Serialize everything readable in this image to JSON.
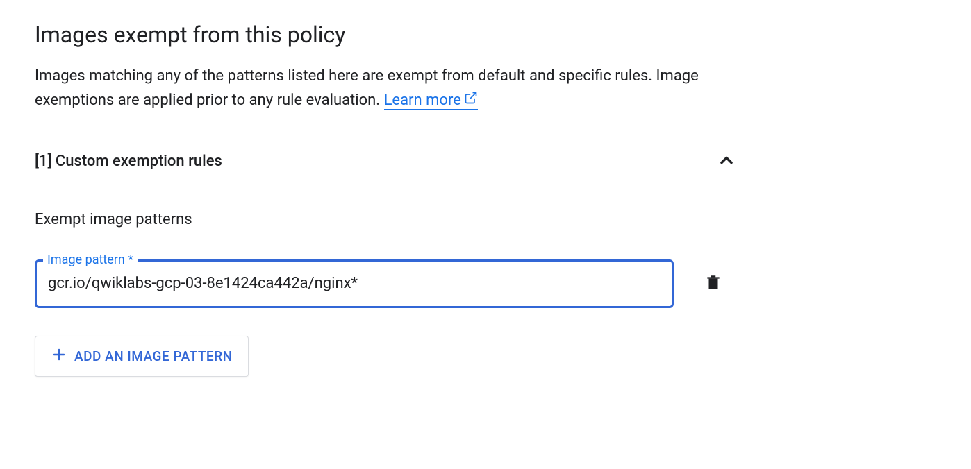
{
  "header": {
    "title": "Images exempt from this policy",
    "description_part1": "Images matching any of the patterns listed here are exempt from default and specific rules. Image exemptions are applied prior to any rule evaluation. ",
    "learn_more": "Learn more"
  },
  "section": {
    "title": "[1] Custom exemption rules",
    "subtitle": "Exempt image patterns"
  },
  "input": {
    "label": "Image pattern *",
    "value": "gcr.io/qwiklabs-gcp-03-8e1424ca442a/nginx*"
  },
  "buttons": {
    "add_label": "ADD AN IMAGE PATTERN"
  }
}
